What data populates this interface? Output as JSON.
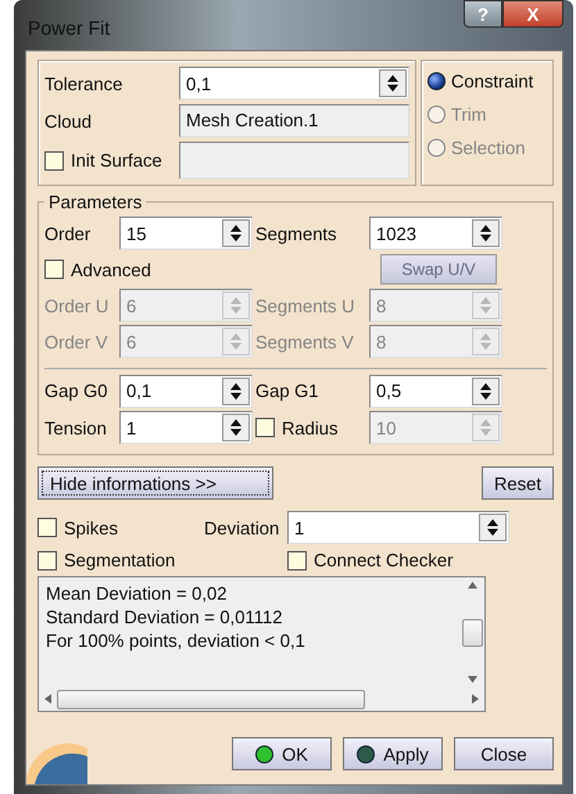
{
  "window": {
    "title": "Power Fit",
    "buttons": [
      {
        "kind": "help",
        "label": "?"
      },
      {
        "kind": "close",
        "label": "X"
      }
    ]
  },
  "source": {
    "fields": [
      {
        "kind": "spin",
        "label": "Tolerance",
        "value": "0,1",
        "disabled": false
      },
      {
        "kind": "text",
        "label": "Cloud",
        "value": "Mesh Creation.1",
        "disabled": true
      },
      {
        "kind": "check",
        "label": "Init Surface",
        "checked": false,
        "disabled": true
      }
    ]
  },
  "modes": [
    {
      "label": "Constraint",
      "selected": true,
      "disabled": false
    },
    {
      "label": "Trim",
      "selected": false,
      "disabled": true
    },
    {
      "label": "Selection",
      "selected": false,
      "disabled": true
    }
  ],
  "parameters": {
    "title": "Parameters",
    "rows": [
      {
        "divider": false,
        "items": [
          {
            "kind": "spin",
            "label": "Order",
            "value": "15",
            "disabled": false
          },
          {
            "kind": "spin",
            "label": "Segments",
            "value": "1023",
            "disabled": false
          }
        ]
      },
      {
        "divider": false,
        "items": [
          {
            "kind": "check",
            "label": "Advanced",
            "checked": false
          },
          {
            "kind": "button",
            "label": "Swap U/V",
            "disabled": true
          }
        ]
      },
      {
        "divider": false,
        "items": [
          {
            "kind": "spin",
            "label": "Order U",
            "value": "6",
            "disabled": true
          },
          {
            "kind": "spin",
            "label": "Segments U",
            "value": "8",
            "disabled": true
          }
        ]
      },
      {
        "divider": false,
        "items": [
          {
            "kind": "spin",
            "label": "Order V",
            "value": "6",
            "disabled": true
          },
          {
            "kind": "spin",
            "label": "Segments V",
            "value": "8",
            "disabled": true
          }
        ]
      },
      {
        "divider": true,
        "items": [
          {
            "kind": "spin",
            "label": "Gap G0",
            "value": "0,1",
            "disabled": false
          },
          {
            "kind": "spin",
            "label": "Gap G1",
            "value": "0,5",
            "disabled": false
          }
        ]
      },
      {
        "divider": false,
        "items": [
          {
            "kind": "spin",
            "label": "Tension",
            "value": "1",
            "disabled": false
          },
          {
            "kind": "checkspin",
            "label": "Radius",
            "checked": false,
            "value": "10",
            "disabled": true
          }
        ]
      }
    ]
  },
  "info_toggle": "Hide informations >>",
  "reset": "Reset",
  "options": {
    "spikes": {
      "label": "Spikes",
      "checked": false
    },
    "deviation": {
      "label": "Deviation",
      "value": "1"
    },
    "segmentation": {
      "label": "Segmentation",
      "checked": false
    },
    "connect_checker": {
      "label": "Connect Checker",
      "checked": false
    }
  },
  "report": {
    "lines": [
      "Mean Deviation = 0,02",
      "Standard Deviation = 0,01112",
      "For 100% points, deviation < 0,1"
    ]
  },
  "footer": [
    {
      "kind": "ok",
      "label": "OK"
    },
    {
      "kind": "apply",
      "label": "Apply"
    },
    {
      "kind": "plain",
      "label": "Close"
    }
  ]
}
